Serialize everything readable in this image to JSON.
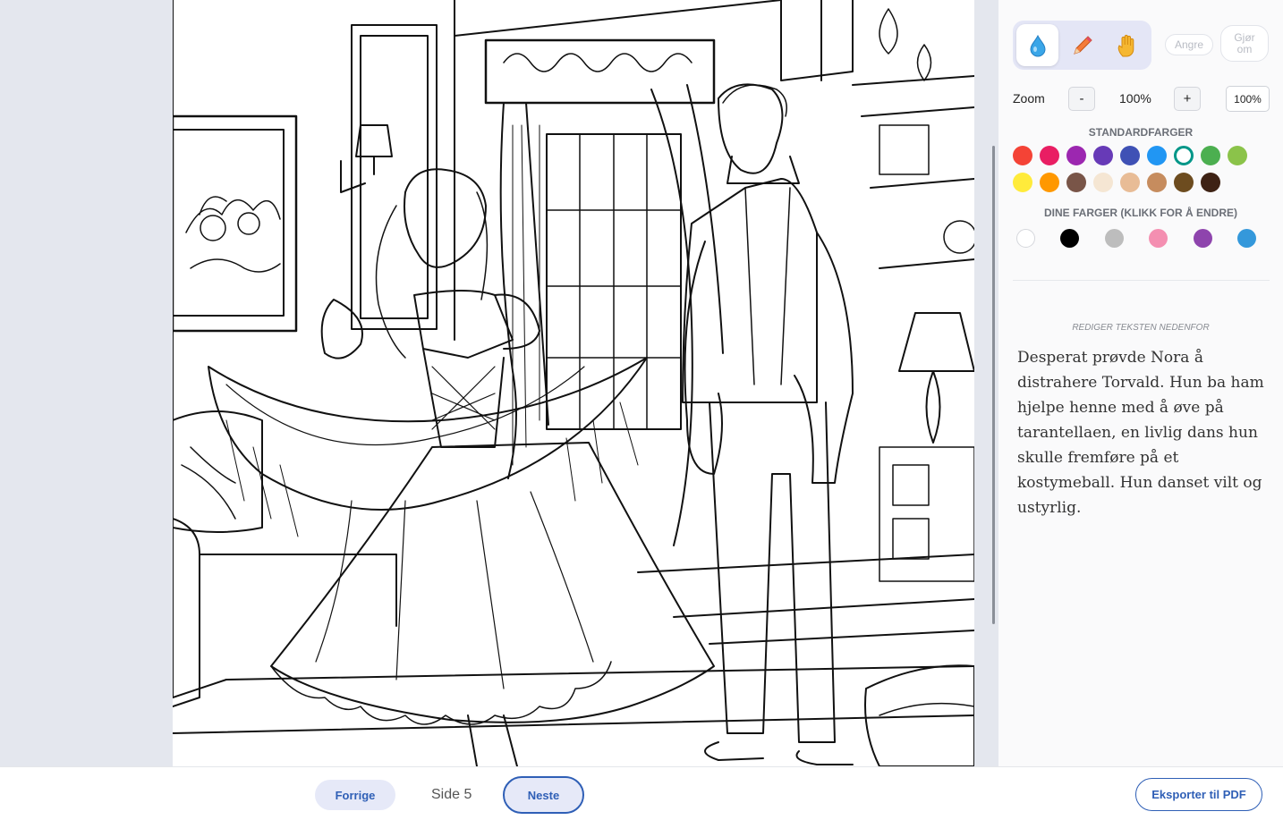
{
  "tools": [
    {
      "name": "fill",
      "icon": "water-drop-icon",
      "active": true
    },
    {
      "name": "pencil",
      "icon": "pencil-icon",
      "active": false
    },
    {
      "name": "pan",
      "icon": "hand-icon",
      "active": false
    }
  ],
  "actions": {
    "undo_label": "Angre",
    "redo_label": "Gjør om"
  },
  "zoom": {
    "label": "Zoom",
    "minus": "-",
    "value": "100%",
    "plus": "+",
    "reset_label": "100%"
  },
  "standard_colors": {
    "title": "STANDARDFARGER",
    "colors": [
      "#f44336",
      "#e91e63",
      "#9c27b0",
      "#673ab7",
      "#3f51b5",
      "#2196f3",
      "#009688",
      "#4caf50",
      "#8bc34a",
      "#ffeb3b",
      "#ff9800",
      "#795548",
      "#f5e6d3",
      "#e8bc96",
      "#c68c5e",
      "#6d4c1f",
      "#3e2214"
    ],
    "selected_index": 6
  },
  "custom_colors": {
    "title": "DINE FARGER (KLIKK FOR Å ENDRE)",
    "colors": [
      "#ffffff",
      "#000000",
      "#bdbdbd",
      "#f48fb1",
      "#8e44ad",
      "#3498db"
    ]
  },
  "text_editor": {
    "label": "REDIGER TEKSTEN NEDENFOR",
    "text": "Desperat prøvde Nora å distrahere Torvald. Hun ba ham hjelpe henne med å øve på tarantellaen, en livlig dans hun skulle fremføre på et kostymeball. Hun danset vilt og ustyrlig."
  },
  "navigation": {
    "prev_label": "Forrige",
    "page_label": "Side 5",
    "next_label": "Neste"
  },
  "export": {
    "label": "Eksporter til PDF"
  }
}
